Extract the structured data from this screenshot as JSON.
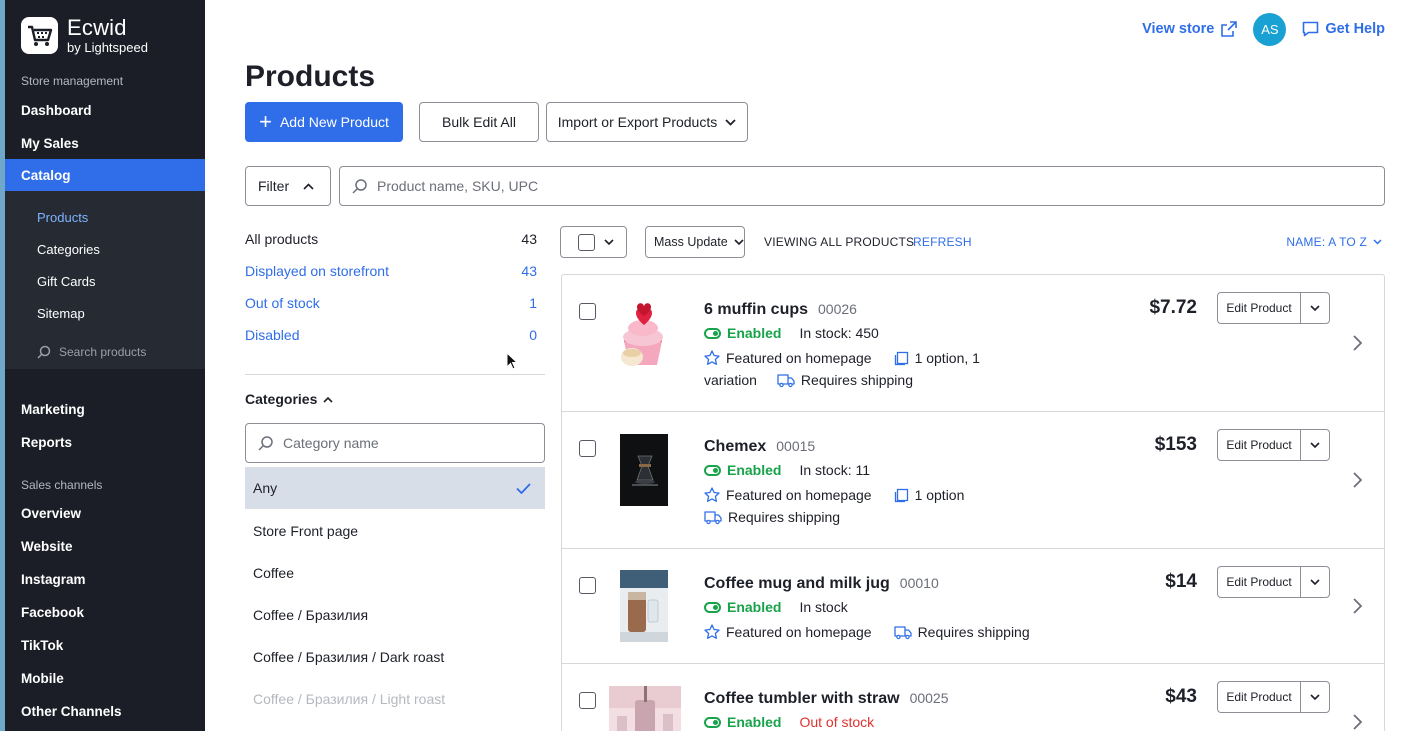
{
  "brand": {
    "name": "Ecwid",
    "sub": "by Lightspeed"
  },
  "sidebar": {
    "section_store": "Store management",
    "items_top": [
      "Dashboard",
      "My Sales"
    ],
    "active": "Catalog",
    "sub_items": [
      "Products",
      "Categories",
      "Gift Cards",
      "Sitemap"
    ],
    "search_placeholder": "Search products",
    "items_mid": [
      "Marketing",
      "Reports"
    ],
    "section_sales": "Sales channels",
    "items_bottom": [
      "Overview",
      "Website",
      "Instagram",
      "Facebook",
      "TikTok",
      "Mobile",
      "Other Channels"
    ]
  },
  "topbar": {
    "view_store": "View store",
    "avatar": "AS",
    "help": "Get Help"
  },
  "page": {
    "title": "Products",
    "add_btn": "Add New Product",
    "bulk_btn": "Bulk Edit All",
    "import_btn": "Import or Export Products",
    "filter_btn": "Filter",
    "search_placeholder": "Product name, SKU, UPC"
  },
  "filters": [
    {
      "label": "All products",
      "count": "43"
    },
    {
      "label": "Displayed on storefront",
      "count": "43"
    },
    {
      "label": "Out of stock",
      "count": "1"
    },
    {
      "label": "Disabled",
      "count": "0"
    }
  ],
  "categories": {
    "title": "Categories",
    "search_placeholder": "Category name",
    "selected": "Any",
    "items": [
      "Store Front page",
      "Coffee",
      "Coffee / Бразилия",
      "Coffee / Бразилия / Dark roast",
      "Coffee / Бразилия / Light roast"
    ]
  },
  "list_toolbar": {
    "mass_update": "Mass Update",
    "viewing": "VIEWING ALL PRODUCTS",
    "refresh": "REFRESH",
    "sort": "NAME: A TO Z"
  },
  "products": [
    {
      "name": "6 muffin cups",
      "sku": "00026",
      "status": "Enabled",
      "stock": "In stock: 450",
      "featured": "Featured on homepage",
      "options": "1 option, 1",
      "options2": "variation",
      "shipping": "Requires shipping",
      "price": "$7.72",
      "edit": "Edit Product"
    },
    {
      "name": "Chemex",
      "sku": "00015",
      "status": "Enabled",
      "stock": "In stock: 11",
      "featured": "Featured on homepage",
      "options": "1 option",
      "shipping": "Requires shipping",
      "price": "$153",
      "edit": "Edit Product"
    },
    {
      "name": "Coffee mug and milk jug",
      "sku": "00010",
      "status": "Enabled",
      "stock": "In stock",
      "featured": "Featured on homepage",
      "shipping": "Requires shipping",
      "price": "$14",
      "edit": "Edit Product"
    },
    {
      "name": "Coffee tumbler with straw",
      "sku": "00025",
      "status": "Enabled",
      "stock": "Out of stock",
      "price": "$43",
      "edit": "Edit Product"
    }
  ]
}
